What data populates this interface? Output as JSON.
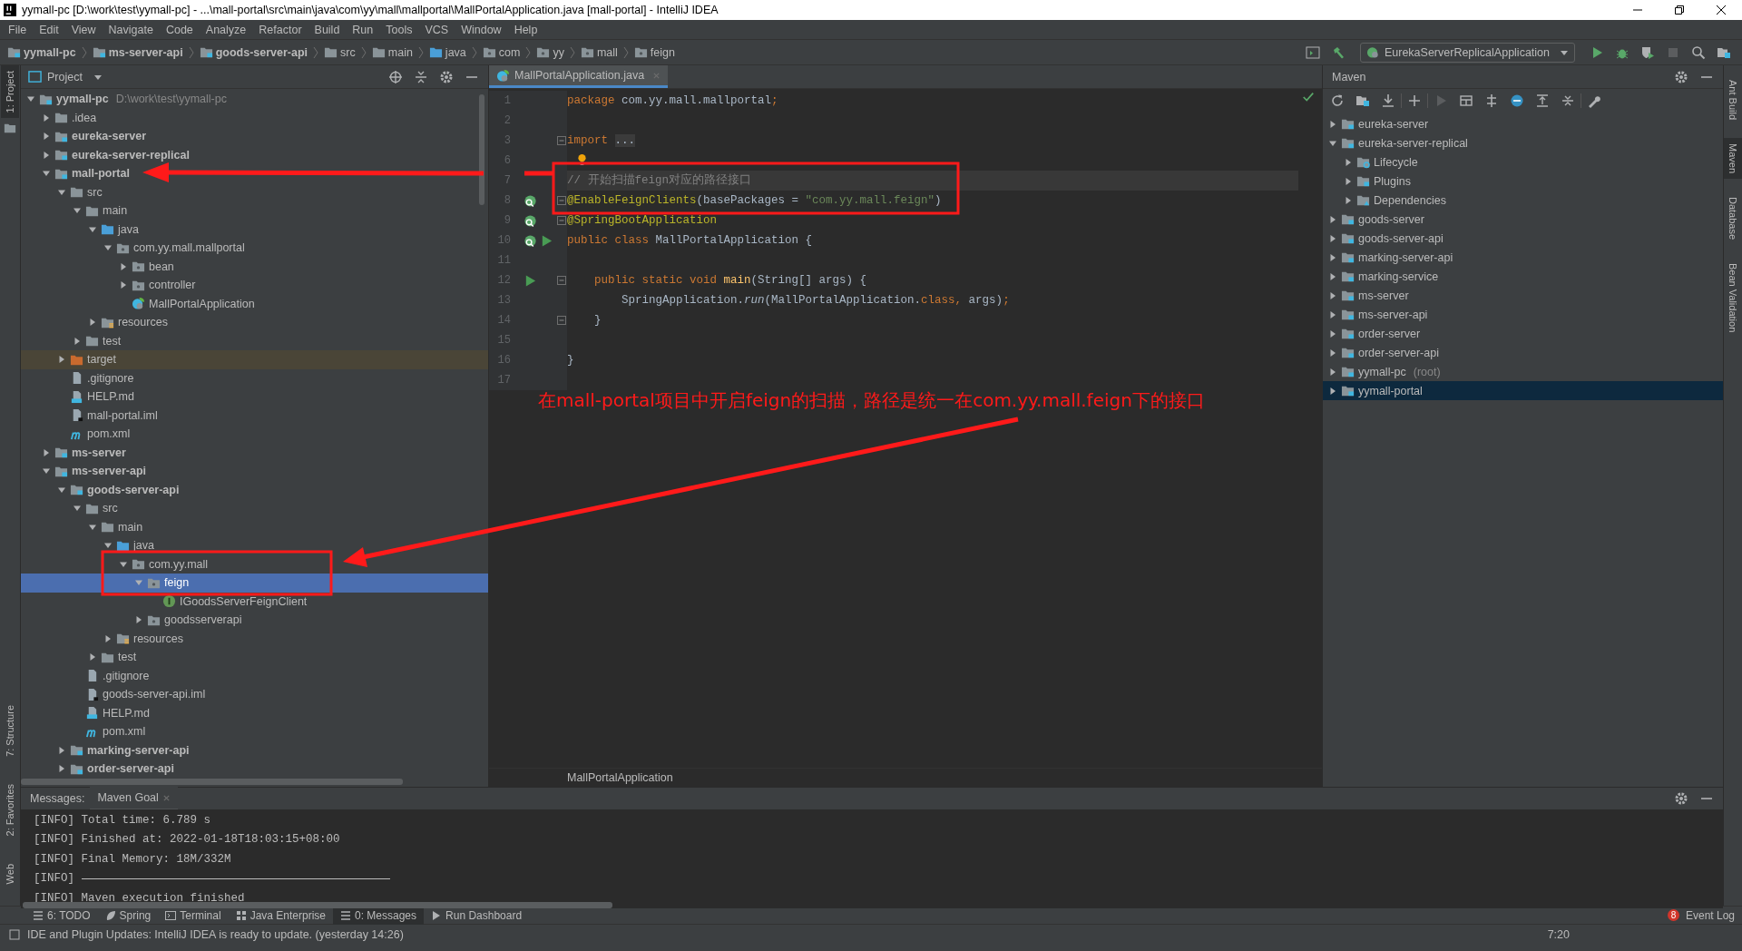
{
  "window": {
    "title": "yymall-pc [D:\\work\\test\\yymall-pc] - ...\\mall-portal\\src\\main\\java\\com\\yy\\mall\\mallportal\\MallPortalApplication.java [mall-portal] - IntelliJ IDEA"
  },
  "menu": [
    "File",
    "Edit",
    "View",
    "Navigate",
    "Code",
    "Analyze",
    "Refactor",
    "Build",
    "Run",
    "Tools",
    "VCS",
    "Window",
    "Help"
  ],
  "breadcrumbs": [
    {
      "label": "yymall-pc",
      "kind": "module"
    },
    {
      "label": "ms-server-api",
      "kind": "module"
    },
    {
      "label": "goods-server-api",
      "kind": "module"
    },
    {
      "label": "src",
      "kind": "folder"
    },
    {
      "label": "main",
      "kind": "folder"
    },
    {
      "label": "java",
      "kind": "source"
    },
    {
      "label": "com",
      "kind": "package"
    },
    {
      "label": "yy",
      "kind": "package"
    },
    {
      "label": "mall",
      "kind": "package"
    },
    {
      "label": "feign",
      "kind": "package"
    }
  ],
  "run_config": {
    "label": "EurekaServerReplicalApplication"
  },
  "left_strip": {
    "top": [
      {
        "label": "1: Project",
        "selected": true
      }
    ],
    "bottom": [
      {
        "label": "7: Structure",
        "selected": false
      },
      {
        "label": "2: Favorites",
        "selected": false
      },
      {
        "label": "Web",
        "selected": false
      }
    ]
  },
  "right_strip": [
    {
      "label": "Ant Build",
      "selected": false
    },
    {
      "label": "Maven",
      "selected": true
    },
    {
      "label": "Database",
      "selected": false
    },
    {
      "label": "Bean Validation",
      "selected": false
    }
  ],
  "project": {
    "title": "Project",
    "tree": [
      {
        "label": "yymall-pc",
        "hint": "D:\\work\\test\\yymall-pc",
        "kind": "module",
        "expanded": true,
        "selected": false,
        "children": [
          {
            "label": ".idea",
            "kind": "folder",
            "expanded": false,
            "selected": false
          },
          {
            "label": "eureka-server",
            "kind": "module",
            "expanded": false,
            "selected": false
          },
          {
            "label": "eureka-server-replical",
            "kind": "module",
            "expanded": false,
            "selected": false
          },
          {
            "label": "mall-portal",
            "kind": "module",
            "expanded": true,
            "selected": false,
            "children": [
              {
                "label": "src",
                "kind": "folder",
                "expanded": true,
                "selected": false,
                "children": [
                  {
                    "label": "main",
                    "kind": "folder",
                    "expanded": true,
                    "selected": false,
                    "children": [
                      {
                        "label": "java",
                        "kind": "source",
                        "expanded": true,
                        "selected": false,
                        "children": [
                          {
                            "label": "com.yy.mall.mallportal",
                            "kind": "package",
                            "expanded": true,
                            "selected": false,
                            "children": [
                              {
                                "label": "bean",
                                "kind": "package",
                                "expanded": false,
                                "selected": false
                              },
                              {
                                "label": "controller",
                                "kind": "package",
                                "expanded": false,
                                "selected": false
                              },
                              {
                                "label": "MallPortalApplication",
                                "kind": "spring_class",
                                "selected": false
                              }
                            ]
                          }
                        ]
                      },
                      {
                        "label": "resources",
                        "kind": "resources",
                        "expanded": false,
                        "selected": false
                      }
                    ]
                  },
                  {
                    "label": "test",
                    "kind": "folder",
                    "expanded": false,
                    "selected": false
                  }
                ]
              },
              {
                "label": "target",
                "kind": "excluded",
                "expanded": false,
                "selected": false
              },
              {
                "label": ".gitignore",
                "kind": "file",
                "selected": false
              },
              {
                "label": "HELP.md",
                "kind": "markdown",
                "selected": false
              },
              {
                "label": "mall-portal.iml",
                "kind": "iml",
                "selected": false
              },
              {
                "label": "pom.xml",
                "kind": "maven",
                "selected": false
              }
            ]
          },
          {
            "label": "ms-server",
            "kind": "module",
            "expanded": false,
            "selected": false
          },
          {
            "label": "ms-server-api",
            "kind": "module",
            "expanded": true,
            "selected": false,
            "children": [
              {
                "label": "goods-server-api",
                "kind": "module",
                "expanded": true,
                "selected": false,
                "children": [
                  {
                    "label": "src",
                    "kind": "folder",
                    "expanded": true,
                    "selected": false,
                    "children": [
                      {
                        "label": "main",
                        "kind": "folder",
                        "expanded": true,
                        "selected": false,
                        "children": [
                          {
                            "label": "java",
                            "kind": "source",
                            "expanded": true,
                            "selected": false,
                            "children": [
                              {
                                "label": "com.yy.mall",
                                "kind": "package",
                                "expanded": true,
                                "selected": false,
                                "children": [
                                  {
                                    "label": "feign",
                                    "kind": "package",
                                    "expanded": true,
                                    "selected": true,
                                    "children": [
                                      {
                                        "label": "IGoodsServerFeignClient",
                                        "kind": "interface",
                                        "selected": false
                                      }
                                    ]
                                  },
                                  {
                                    "label": "goodsserverapi",
                                    "kind": "package",
                                    "expanded": false,
                                    "selected": false
                                  }
                                ]
                              }
                            ]
                          },
                          {
                            "label": "resources",
                            "kind": "resources",
                            "expanded": false,
                            "selected": false
                          }
                        ]
                      },
                      {
                        "label": "test",
                        "kind": "folder",
                        "expanded": false,
                        "selected": false
                      }
                    ]
                  },
                  {
                    "label": ".gitignore",
                    "kind": "file",
                    "selected": false
                  },
                  {
                    "label": "goods-server-api.iml",
                    "kind": "iml",
                    "selected": false
                  },
                  {
                    "label": "HELP.md",
                    "kind": "markdown",
                    "selected": false
                  },
                  {
                    "label": "pom.xml",
                    "kind": "maven",
                    "selected": false
                  }
                ]
              },
              {
                "label": "marking-server-api",
                "kind": "module",
                "expanded": false,
                "selected": false
              },
              {
                "label": "order-server-api",
                "kind": "module",
                "expanded": false,
                "selected": false
              }
            ]
          }
        ]
      }
    ]
  },
  "editor": {
    "tab": {
      "label": "MallPortalApplication.java",
      "selected": true
    },
    "breadcrumb": "MallPortalApplication",
    "lines": [
      {
        "number": "1",
        "current": false,
        "fold": false,
        "tokens": [
          {
            "kind": "keyword",
            "text": "package "
          },
          {
            "kind": "plain",
            "text": "com.yy.mall.mallportal"
          },
          {
            "kind": "keyword",
            "text": ";"
          }
        ]
      },
      {
        "number": "2",
        "current": false,
        "fold": false
      },
      {
        "number": "3",
        "current": false,
        "fold": true,
        "tokens": [
          {
            "kind": "keyword",
            "text": "import "
          },
          {
            "kind": "folded",
            "text": "..."
          }
        ]
      },
      {
        "number": "6",
        "current": false,
        "fold": false,
        "gutter_icons": [
          {
            "kind": "bulb"
          }
        ]
      },
      {
        "number": "7",
        "current": true,
        "fold": false,
        "tokens": [
          {
            "kind": "comment",
            "text": "// 开始扫描feign对应的路径接口"
          }
        ]
      },
      {
        "number": "8",
        "current": false,
        "fold": true,
        "gutter_icons": [
          {
            "kind": "bean"
          }
        ],
        "tokens": [
          {
            "kind": "annotation",
            "text": "@EnableFeignClients"
          },
          {
            "kind": "plain",
            "text": "(basePackages = "
          },
          {
            "kind": "string",
            "text": "\"com.yy.mall.feign\""
          },
          {
            "kind": "plain",
            "text": ")"
          }
        ]
      },
      {
        "number": "9",
        "current": false,
        "fold": true,
        "gutter_icons": [
          {
            "kind": "bean"
          }
        ],
        "tokens": [
          {
            "kind": "annotation",
            "text": "@SpringBootApplication"
          }
        ]
      },
      {
        "number": "10",
        "current": false,
        "fold": false,
        "gutter_icons": [
          {
            "kind": "bean"
          },
          {
            "kind": "run"
          }
        ],
        "tokens": [
          {
            "kind": "keyword",
            "text": "public class "
          },
          {
            "kind": "plain",
            "text": "MallPortalApplication {"
          }
        ]
      },
      {
        "number": "11",
        "current": false,
        "fold": false
      },
      {
        "number": "12",
        "current": false,
        "fold": true,
        "gutter_icons": [
          {
            "kind": "run"
          }
        ],
        "tokens": [
          {
            "kind": "keyword",
            "text": "    public static void "
          },
          {
            "kind": "method",
            "text": "main"
          },
          {
            "kind": "plain",
            "text": "(String[] args) {"
          }
        ]
      },
      {
        "number": "13",
        "current": false,
        "fold": false,
        "tokens": [
          {
            "kind": "plain",
            "text": "        SpringApplication."
          },
          {
            "kind": "static_call",
            "text": "run"
          },
          {
            "kind": "plain",
            "text": "(MallPortalApplication."
          },
          {
            "kind": "keyword",
            "text": "class,"
          },
          {
            "kind": "plain",
            "text": " args)"
          },
          {
            "kind": "keyword",
            "text": ";"
          }
        ]
      },
      {
        "number": "14",
        "current": false,
        "fold": true,
        "tokens": [
          {
            "kind": "plain",
            "text": "    }"
          }
        ]
      },
      {
        "number": "15",
        "current": false,
        "fold": false
      },
      {
        "number": "16",
        "current": false,
        "fold": false,
        "tokens": [
          {
            "kind": "plain",
            "text": "}"
          }
        ]
      },
      {
        "number": "17",
        "current": false,
        "fold": false
      }
    ]
  },
  "annotation": {
    "text": "在mall-portal项目中开启feign的扫描，路径是统一在com.yy.mall.feign下的接口"
  },
  "maven": {
    "title": "Maven",
    "tree": [
      {
        "label": "eureka-server",
        "kind": "project",
        "expanded": false,
        "selected": false
      },
      {
        "label": "eureka-server-replical",
        "kind": "project",
        "expanded": true,
        "selected": false,
        "children": [
          {
            "label": "Lifecycle",
            "kind": "lifecycle",
            "expanded": false,
            "selected": false
          },
          {
            "label": "Plugins",
            "kind": "plugins",
            "expanded": false,
            "selected": false
          },
          {
            "label": "Dependencies",
            "kind": "dependencies",
            "expanded": false,
            "selected": false
          }
        ]
      },
      {
        "label": "goods-server",
        "kind": "project",
        "expanded": false,
        "selected": false
      },
      {
        "label": "goods-server-api",
        "kind": "project",
        "expanded": false,
        "selected": false
      },
      {
        "label": "marking-server-api",
        "kind": "project",
        "expanded": false,
        "selected": false
      },
      {
        "label": "marking-service",
        "kind": "project",
        "expanded": false,
        "selected": false
      },
      {
        "label": "ms-server",
        "kind": "project",
        "expanded": false,
        "selected": false
      },
      {
        "label": "ms-server-api",
        "kind": "project",
        "expanded": false,
        "selected": false
      },
      {
        "label": "order-server",
        "kind": "project",
        "expanded": false,
        "selected": false
      },
      {
        "label": "order-server-api",
        "kind": "project",
        "expanded": false,
        "selected": false
      },
      {
        "label": "yymall-pc",
        "hint": "(root)",
        "kind": "project",
        "expanded": false,
        "selected": false
      },
      {
        "label": "yymall-portal",
        "kind": "project",
        "expanded": false,
        "selected": true
      }
    ]
  },
  "messages": {
    "label": "Messages:",
    "tabs": [
      {
        "label": "Maven Goal",
        "selected": true
      }
    ],
    "log": [
      {
        "kind": "text",
        "text": "[INFO] Total time: 6.789 s"
      },
      {
        "kind": "text",
        "text": "[INFO] Finished at: 2022-01-18T18:03:15+08:00"
      },
      {
        "kind": "text",
        "text": "[INFO] Final Memory: 18M/332M"
      },
      {
        "kind": "rule",
        "text": "[INFO]"
      },
      {
        "kind": "text",
        "text": "[INFO] Maven execution finished"
      }
    ]
  },
  "tool_tabs": [
    {
      "label": "6: TODO",
      "kind": "todo",
      "selected": false
    },
    {
      "label": "Spring",
      "kind": "spring",
      "selected": false
    },
    {
      "label": "Terminal",
      "kind": "terminal",
      "selected": false
    },
    {
      "label": "Java Enterprise",
      "kind": "enterprise",
      "selected": false
    },
    {
      "label": "0: Messages",
      "kind": "messages",
      "selected": true
    },
    {
      "label": "Run Dashboard",
      "kind": "run_dashboard",
      "selected": false
    }
  ],
  "event_log": {
    "label": "Event Log",
    "count": "8"
  },
  "status_bar": {
    "message": "IDE and Plugin Updates: IntelliJ IDEA is ready to update. (yesterday 14:26)",
    "position": "7:20"
  }
}
